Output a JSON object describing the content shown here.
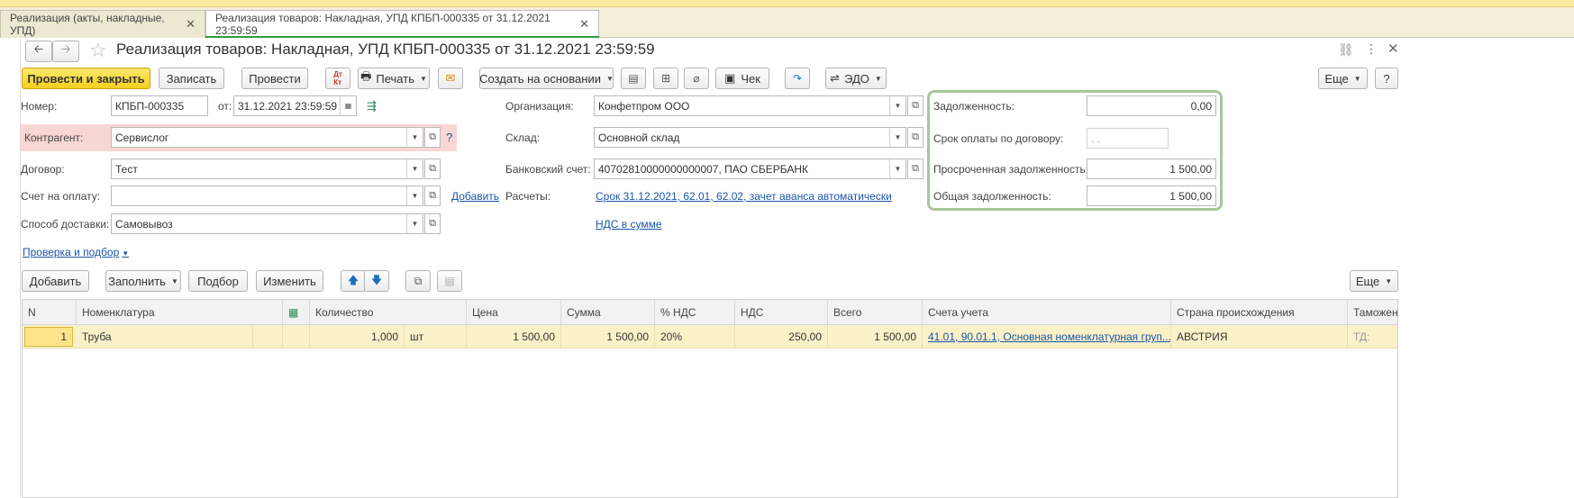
{
  "tabs": [
    {
      "label": "Реализация (акты, накладные, УПД)"
    },
    {
      "label": "Реализация товаров: Накладная, УПД КПБП-000335 от 31.12.2021 23:59:59"
    }
  ],
  "header": {
    "title": "Реализация товаров: Накладная, УПД КПБП-000335 от 31.12.2021 23:59:59"
  },
  "toolbar": {
    "post_close": "Провести и закрыть",
    "save": "Записать",
    "post": "Провести",
    "print": "Печать",
    "create_based": "Создать на основании",
    "check": "Чек",
    "edo": "ЭДО",
    "more": "Еще",
    "help": "?"
  },
  "form": {
    "number_label": "Номер:",
    "number_value": "КПБП-000335",
    "from_label": "от:",
    "date_value": "31.12.2021 23:59:59",
    "counterparty_label": "Контрагент:",
    "counterparty_value": "Сервислог",
    "contract_label": "Договор:",
    "contract_value": "Тест",
    "invoice_label": "Счет на оплату:",
    "invoice_value": "",
    "add_link": "Добавить",
    "delivery_label": "Способ доставки:",
    "delivery_value": "Самовывоз",
    "check_link": "Проверка и подбор",
    "org_label": "Организация:",
    "org_value": "Конфетпром ООО",
    "warehouse_label": "Склад:",
    "warehouse_value": "Основной склад",
    "bank_label": "Банковский счет:",
    "bank_value": "40702810000000000007, ПАО СБЕРБАНК",
    "settlements_label": "Расчеты:",
    "settlements_link": "Срок 31.12.2021, 62.01, 62.02, зачет аванса автоматически",
    "vat_link": "НДС в сумме"
  },
  "debt": {
    "debt_label": "Задолженность:",
    "debt_value": "0,00",
    "term_label": "Срок оплаты по договору:",
    "term_value": " .  .",
    "overdue_label": "Просроченная задолженность:",
    "overdue_value": "1 500,00",
    "total_label": "Общая задолженность:",
    "total_value": "1 500,00"
  },
  "table_toolbar": {
    "add": "Добавить",
    "fill": "Заполнить",
    "pick": "Подбор",
    "change": "Изменить",
    "more": "Еще"
  },
  "table": {
    "columns": [
      "N",
      "Номенклатура",
      "Количество",
      "Цена",
      "Сумма",
      "% НДС",
      "НДС",
      "Всего",
      "Счета учета",
      "Страна происхождения",
      "Таможен"
    ],
    "rows": [
      {
        "n": "1",
        "item": "Труба",
        "qty": "1,000",
        "unit": "шт",
        "price": "1 500,00",
        "sum": "1 500,00",
        "vat_rate": "20%",
        "vat": "250,00",
        "total": "1 500,00",
        "accounts": "41.01, 90.01.1, Основная номенклатурная груп...",
        "country": "АВСТРИЯ",
        "customs": "ТД:"
      }
    ]
  },
  "colors": {
    "accent_yellow": "#f4cf1d",
    "tab_underline": "#2f9a41",
    "counterparty_highlight": "#f8d6d3",
    "debt_panel_border": "#a9c79a",
    "link": "#1a56a6",
    "selected_row": "#fbf1c9"
  }
}
